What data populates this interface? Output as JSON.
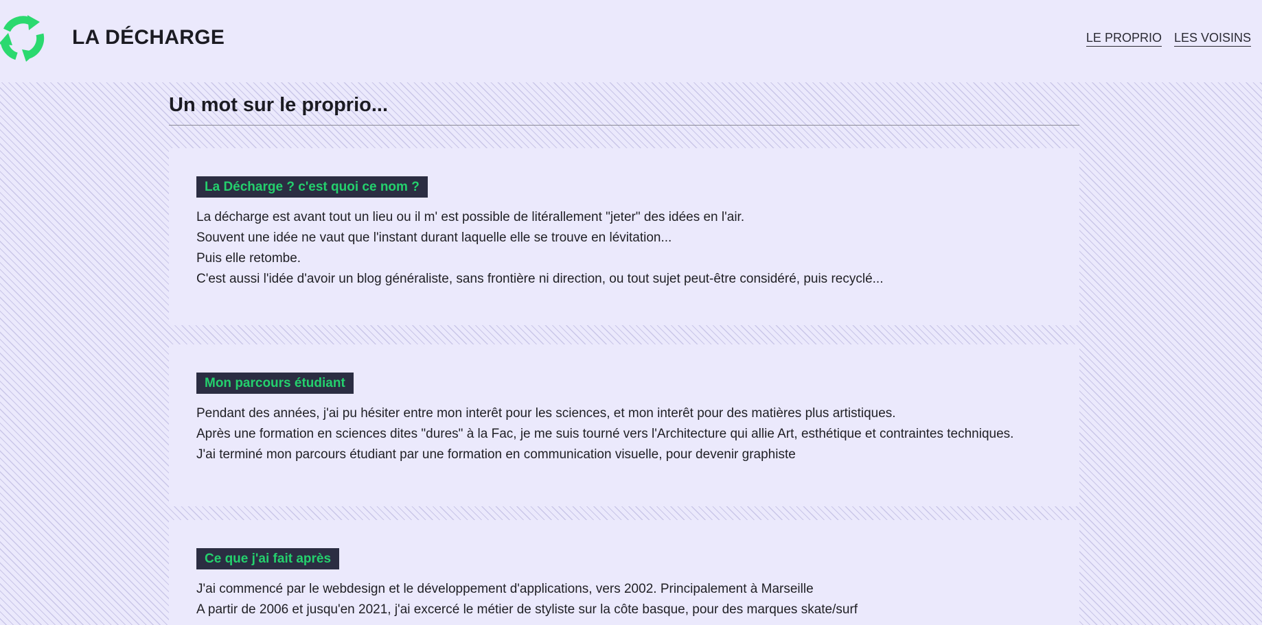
{
  "header": {
    "site_title": "LA DÉCHARGE",
    "logo_icon": "recycle-arrows-icon",
    "brand_color": "#2bd96f",
    "nav": [
      {
        "label": "LE PROPRIO"
      },
      {
        "label": "LES VOISINS"
      }
    ]
  },
  "main": {
    "page_title": "Un mot sur le proprio...",
    "sections": [
      {
        "heading": "La Décharge ? c'est quoi ce nom ?",
        "lines": [
          "La décharge est avant tout un lieu ou il m' est possible de litérallement \"jeter\" des idées en l'air.",
          "Souvent une idée ne vaut que l'instant durant laquelle elle se trouve en lévitation...",
          "Puis elle retombe.",
          "C'est aussi l'idée d'avoir un blog généraliste, sans frontière ni direction, ou tout sujet peut-être considéré, puis recyclé..."
        ]
      },
      {
        "heading": "Mon parcours étudiant",
        "lines": [
          "Pendant des années, j'ai pu hésiter entre mon interêt pour les sciences, et mon interêt pour des matières plus artistiques.",
          "Après une formation en sciences dites \"dures\" à la Fac, je me suis tourné vers l'Architecture qui allie Art, esthétique et contraintes techniques.",
          "J'ai terminé mon parcours étudiant par une formation en communication visuelle, pour devenir graphiste"
        ]
      },
      {
        "heading": "Ce que j'ai fait après",
        "lines": [
          "J'ai commencé par le webdesign et le développement d'applications, vers 2002. Principalement à Marseille",
          "A partir de 2006 et jusqu'en 2021, j'ai excercé le métier de styliste sur la côte basque, pour des marques skate/surf"
        ]
      }
    ]
  },
  "colors": {
    "background": "#ebe9fc",
    "hatch_line": "#c9c6e8",
    "heading_bg": "#2b2d42",
    "heading_text": "#24d06d"
  }
}
